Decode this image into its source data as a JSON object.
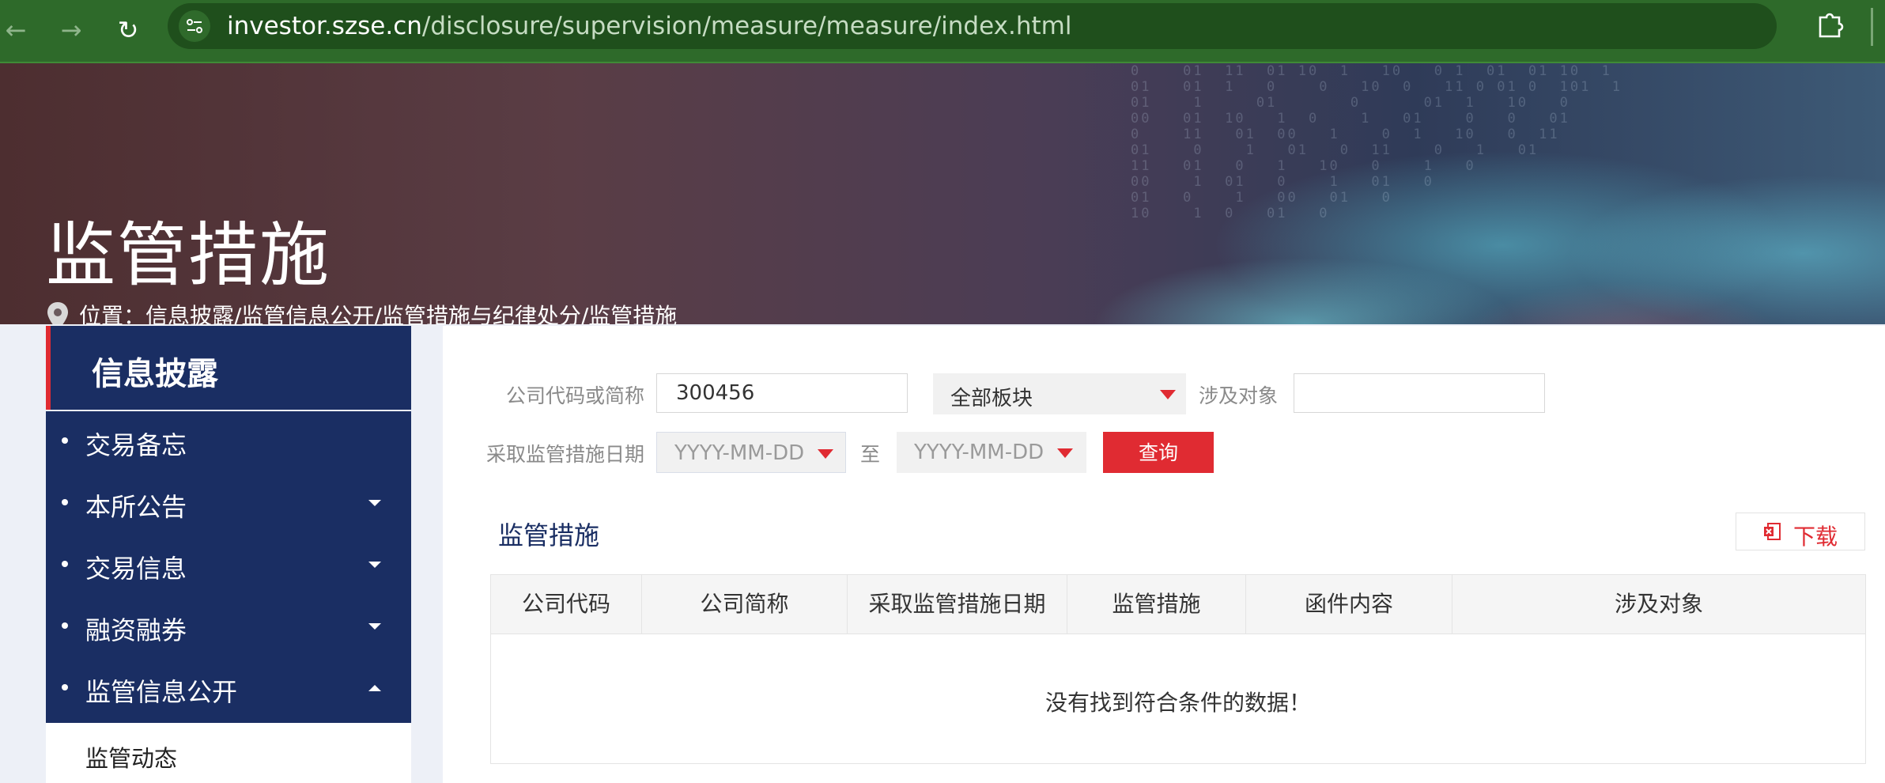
{
  "browser": {
    "url_host": "investor.szse.cn",
    "url_path": "/disclosure/supervision/measure/measure/index.html"
  },
  "hero": {
    "title": "监管措施",
    "breadcrumb": "位置：信息披露/监管信息公开/监管措施与纪律处分/监管措施"
  },
  "sidebar": {
    "heading": "信息披露",
    "items": [
      {
        "label": "交易备忘",
        "has_caret": false
      },
      {
        "label": "本所公告",
        "has_caret": true,
        "expanded": false
      },
      {
        "label": "交易信息",
        "has_caret": true,
        "expanded": false
      },
      {
        "label": "融资融券",
        "has_caret": true,
        "expanded": false
      },
      {
        "label": "监管信息公开",
        "has_caret": true,
        "expanded": true
      }
    ],
    "subitems": [
      {
        "label": "监管动态"
      }
    ]
  },
  "filters": {
    "company_label": "公司代码或简称",
    "company_value": "300456",
    "board_select": "全部板块",
    "target_label": "涉及对象",
    "target_value": "",
    "date_label": "采取监管措施日期",
    "date_from_placeholder": "YYYY-MM-DD",
    "date_separator": "至",
    "date_to_placeholder": "YYYY-MM-DD",
    "query_button": "查询"
  },
  "results": {
    "section_title": "监管措施",
    "download_label": "下载",
    "columns": [
      "公司代码",
      "公司简称",
      "采取监管措施日期",
      "监管措施",
      "函件内容",
      "涉及对象"
    ],
    "rows": [],
    "empty_message": "没有找到符合条件的数据！"
  },
  "colors": {
    "navy": "#1a2e63",
    "accent_red": "#e02b32",
    "chrome_green": "#2e6a2a"
  }
}
